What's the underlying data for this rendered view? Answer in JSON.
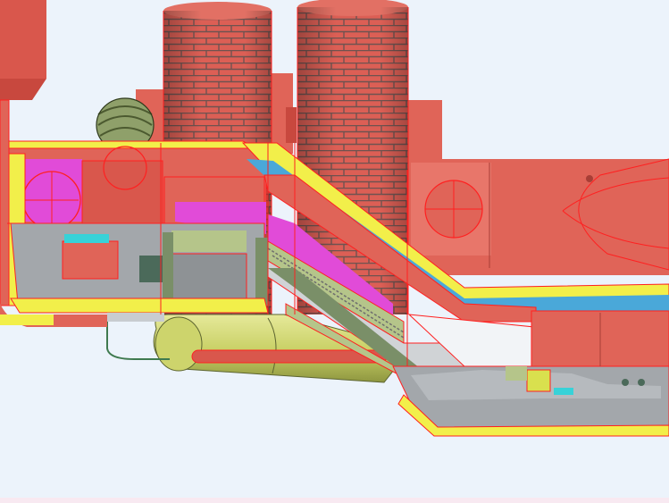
{
  "viewport": {
    "background": "#ecf3fb",
    "clash_edge_color": "#ff2020"
  },
  "model": {
    "colors": {
      "structure": "#e06458",
      "structure_dark": "#c8483e",
      "brick_mortar": "#7a5a58",
      "wall_gray": "#9ba0a4",
      "floor_yellow": "#f2ef4a",
      "duct_olive": "#c7cf63",
      "duct_green": "#b5c58a",
      "tunnel_blue": "#4aa8d9",
      "tunnel_magenta": "#e14bd8",
      "equipment_cyan": "#37d2d8",
      "pale_white": "#f2f4f7"
    }
  }
}
